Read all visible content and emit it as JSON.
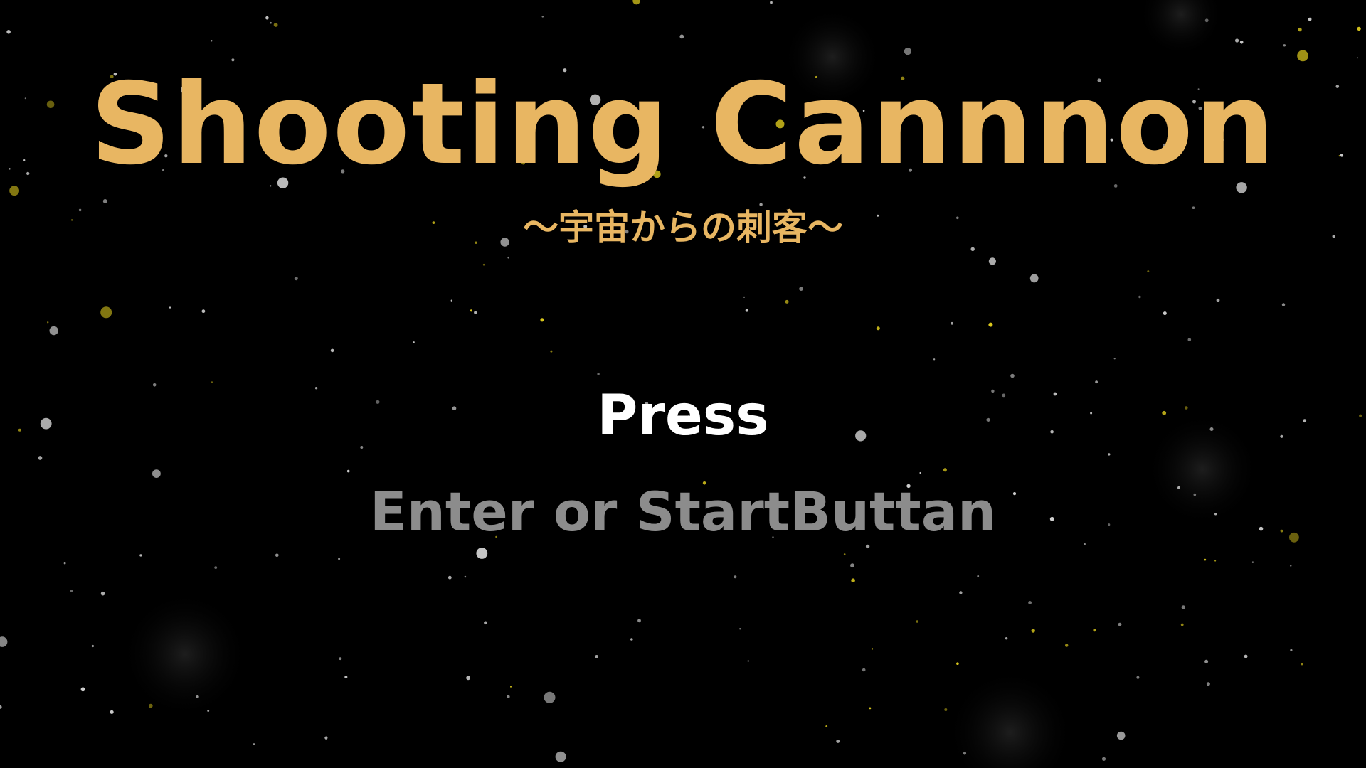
{
  "title_screen": {
    "title": "Shooting Cannnon",
    "subtitle": "〜宇宙からの刺客〜",
    "press_label": "Press",
    "prompt_label": "Enter or StartButtan"
  },
  "colors": {
    "background": "#000000",
    "title": "#E8B662",
    "subtitle": "#E8B662",
    "press": "#FFFFFF",
    "prompt": "#8C8C8C",
    "star_white": "#DADADA",
    "star_yellow": "#E6D21E"
  },
  "background": {
    "type": "starfield",
    "icon": "star-icon"
  }
}
